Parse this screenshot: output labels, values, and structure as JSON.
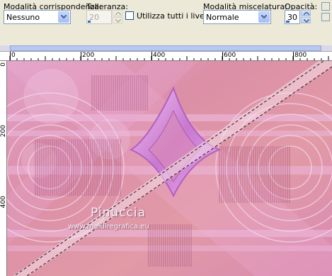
{
  "toolbar": {
    "match_mode": {
      "label": "Modalità corrispondenza:",
      "value": "Nessuno"
    },
    "tolerance": {
      "label": "Tolleranza:",
      "value": "20"
    },
    "use_all_layers": {
      "label": "Utilizza tutti i livelli",
      "checked": false
    },
    "blend_mode": {
      "label": "Modalità miscelatura:",
      "value": "Normale"
    },
    "opacity": {
      "label": "Opacità:",
      "value": "30",
      "fill_percent": 30
    }
  },
  "ruler": {
    "top_labels": [
      "0",
      "200",
      "400",
      "600",
      "800"
    ],
    "left_labels": [
      "0",
      "200",
      "400"
    ]
  },
  "canvas": {
    "watermark_title": "Pinuccia",
    "watermark_url": "www.maidiregrafica.eu",
    "colors": {
      "base": "#dc90a6",
      "accent": "#e0a0d8",
      "diamond": "#c878d0"
    }
  },
  "icons": [
    "chevron-down-icon",
    "spin-up-icon",
    "spin-down-icon",
    "pin-icon"
  ]
}
